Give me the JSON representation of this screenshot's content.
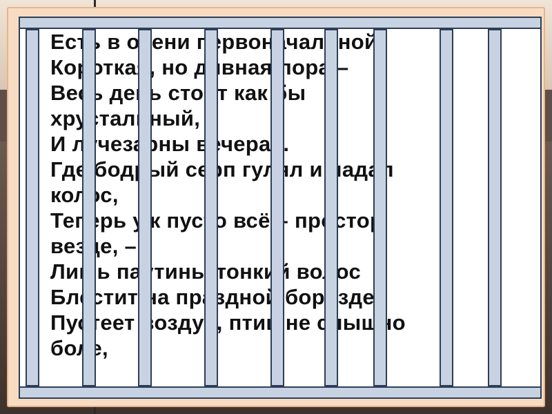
{
  "poem": {
    "lines": [
      "Есть в осени первоначальной",
      "Короткая, но дивная пора –",
      "Весь день стоит как бы",
      "хрустальный,",
      "И лучезарны вечера...",
      "Где бодрый серп гулял и падал",
      "колос,",
      "Теперь уж пусто всё – простор",
      "везде, –",
      "Лишь паутины тонкий волос",
      "Блестит на праздной борозде.",
      "Пустеет воздух, птиц не слышно",
      "боле,"
    ]
  },
  "colors": {
    "board": "#f7dcc3",
    "bars": "#c7d3e3",
    "bar_outline": "#2f3e56",
    "text": "#111111"
  }
}
